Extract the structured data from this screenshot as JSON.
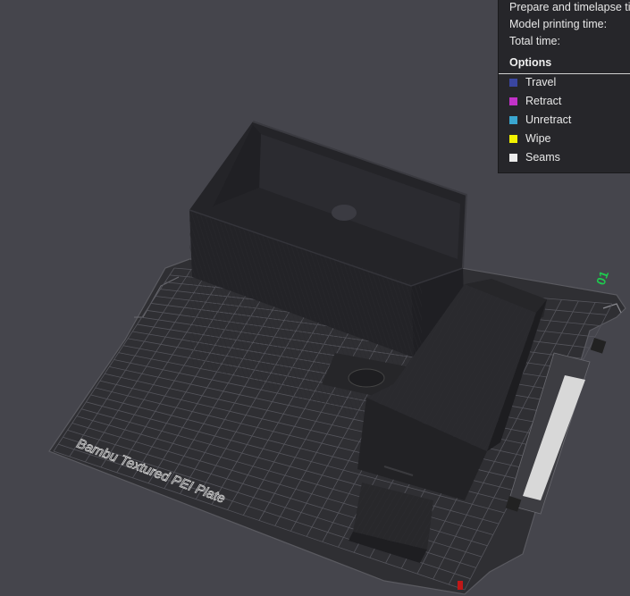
{
  "stats": {
    "prepare_label": "Prepare and timelapse time:",
    "model_time_label": "Model printing time:",
    "total_time_label": "Total time:"
  },
  "options": {
    "header": "Options",
    "items": [
      {
        "label": "Travel",
        "color": "#3a46a0",
        "icon": "travel-swatch-icon"
      },
      {
        "label": "Retract",
        "color": "#c232c8",
        "icon": "retract-swatch-icon"
      },
      {
        "label": "Unretract",
        "color": "#3aa6d0",
        "icon": "unretract-swatch-icon"
      },
      {
        "label": "Wipe",
        "color": "#f2f200",
        "icon": "wipe-swatch-icon"
      },
      {
        "label": "Seams",
        "color": "#ececec",
        "icon": "seams-swatch-icon"
      }
    ]
  },
  "plate": {
    "label": "Bambu Textured PEI Plate",
    "number": "01"
  }
}
